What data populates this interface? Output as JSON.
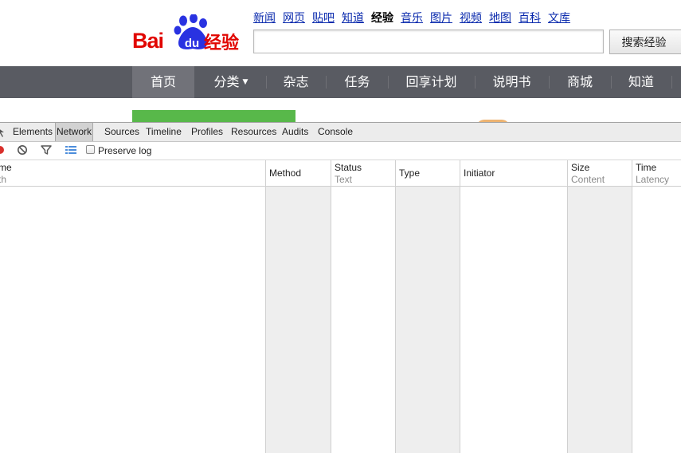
{
  "logo": {
    "bai": "Bai",
    "du": "du",
    "jingyan": "经验"
  },
  "topnav": [
    "新闻",
    "网页",
    "贴吧",
    "知道",
    "经验",
    "音乐",
    "图片",
    "视频",
    "地图",
    "百科",
    "文库"
  ],
  "topnav_current": "经验",
  "search": {
    "value": "",
    "button": "搜索经验"
  },
  "navbar": {
    "items": [
      "首页",
      "分类",
      "杂志",
      "任务",
      "回享计划",
      "说明书",
      "商城",
      "知道"
    ],
    "active": "首页",
    "dropdown_icon": "chevron-down-icon"
  },
  "devtools": {
    "tabs": [
      "Elements",
      "Network",
      "Sources",
      "Timeline",
      "Profiles",
      "Resources",
      "Audits",
      "Console"
    ],
    "active_tab": "Network",
    "toolbar": {
      "icons": [
        "record-icon",
        "clear-icon",
        "filter-icon",
        "list-view-icon"
      ],
      "preserve_log_label": "Preserve log",
      "preserve_log_checked": false
    },
    "columns": [
      {
        "top": "me",
        "bottom": "th"
      },
      {
        "top": "Method",
        "bottom": ""
      },
      {
        "top": "Status",
        "bottom": "Text"
      },
      {
        "top": "Type",
        "bottom": ""
      },
      {
        "top": "Initiator",
        "bottom": ""
      },
      {
        "top": "Size",
        "bottom": "Content"
      },
      {
        "top": "Time",
        "bottom": "Latency"
      }
    ],
    "rows": []
  },
  "colors": {
    "baidu_red": "#e10601",
    "baidu_blue": "#2932e1",
    "navbar": "#595b62",
    "link": "#0a2aad"
  }
}
